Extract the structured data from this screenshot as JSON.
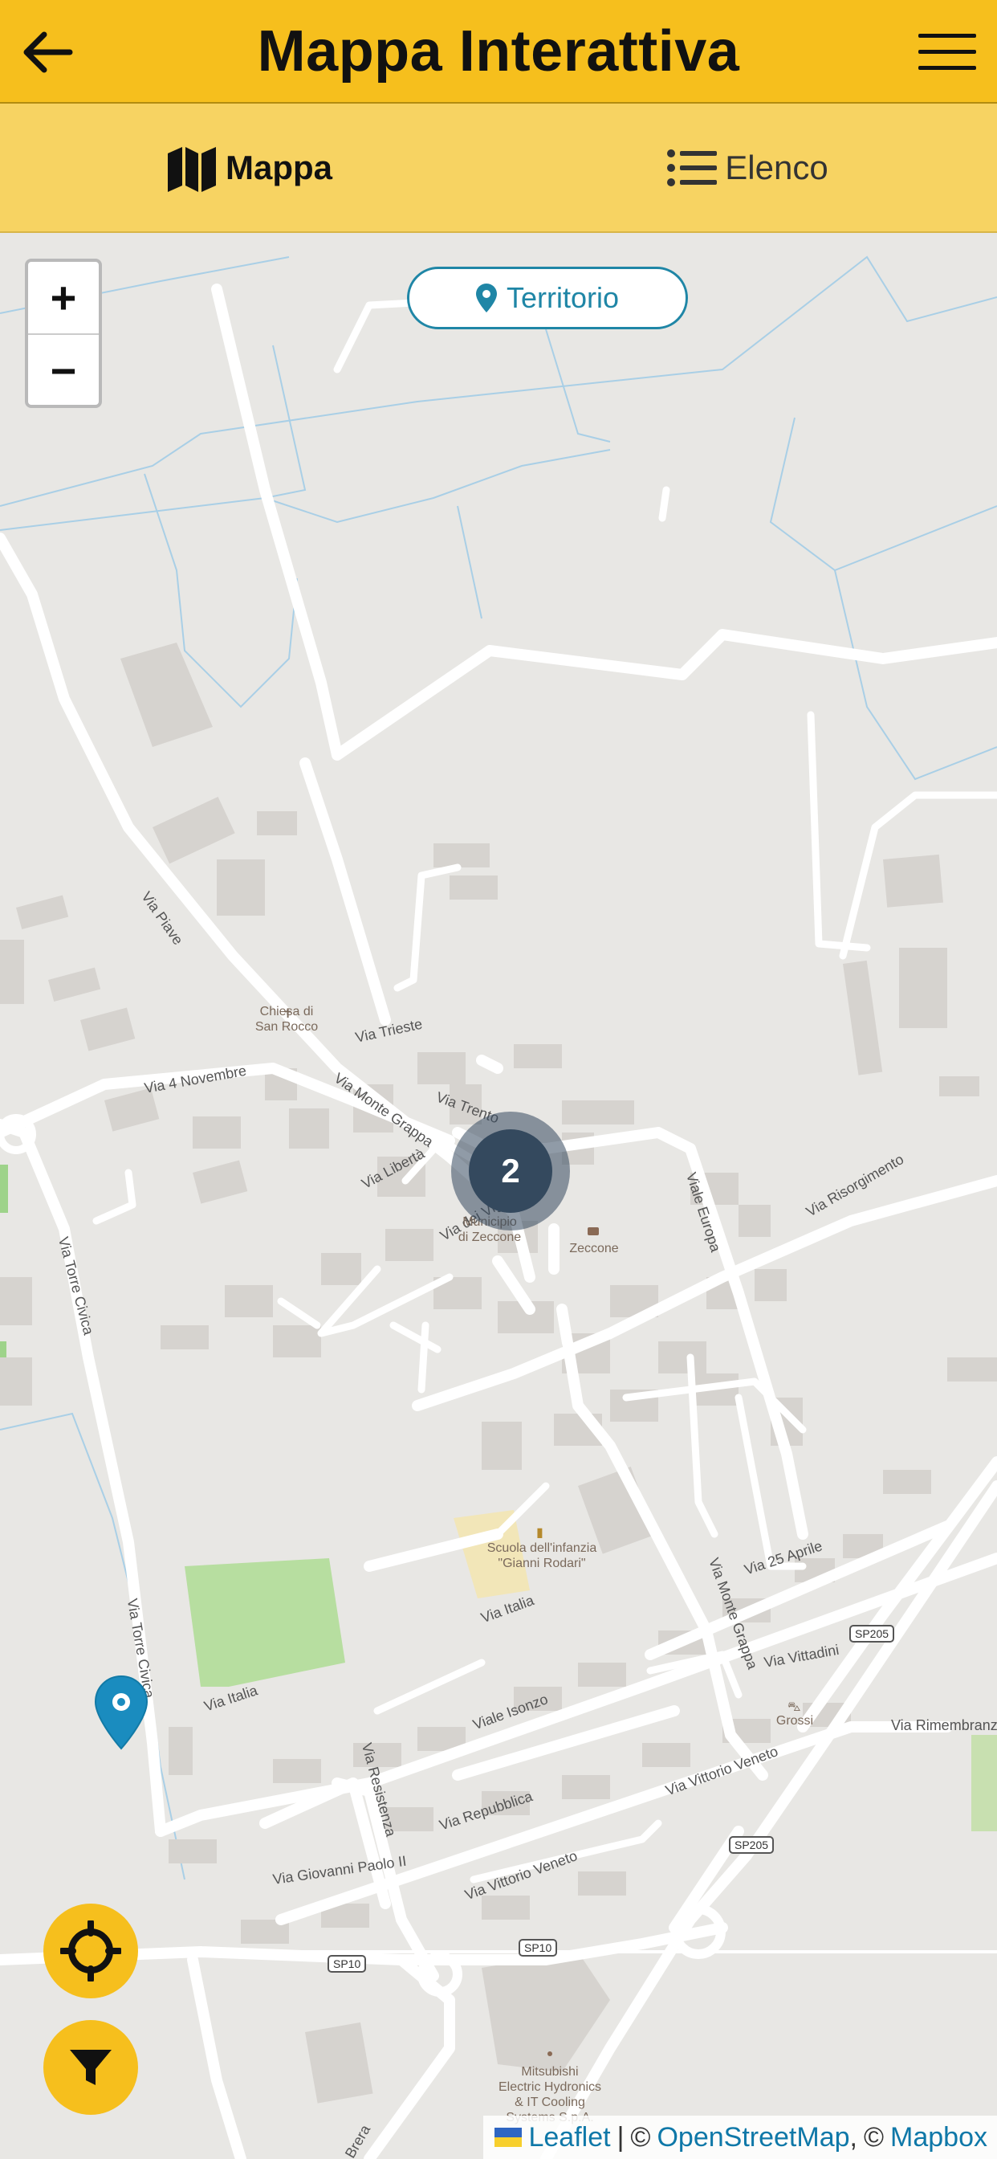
{
  "header": {
    "title": "Mappa Interattiva",
    "back_icon": "arrow-left-icon",
    "menu_icon": "hamburger-menu-icon"
  },
  "tabs": [
    {
      "label": "Mappa",
      "icon": "map-icon",
      "active": true
    },
    {
      "label": "Elenco",
      "icon": "list-icon",
      "active": false
    }
  ],
  "map": {
    "zoom_in_label": "+",
    "zoom_out_label": "−",
    "territorio_label": "Territorio",
    "cluster_count": "2",
    "streets": [
      "Via Piave",
      "Via Trieste",
      "Via 4 Novembre",
      "Via Monte Grappa",
      "Via Trento",
      "Via Libertà",
      "Via dei Vignoli",
      "Viale Europa",
      "Via Risorgimento",
      "Via Torre Civica",
      "Via Torre Civica",
      "Via 25 Aprile",
      "Via Italia",
      "Via Italia",
      "Via Monte Grappa",
      "Via Vittadini",
      "Viale Isonzo",
      "Via Resistenza",
      "Via Rimembranze",
      "Via Repubblica",
      "Via Vittorio Veneto",
      "Via Giovanni Paolo II",
      "Via Vittorio Veneto",
      "Brera"
    ],
    "pois": [
      "Chiesa di\nSan Rocco",
      "Municipio\ndi Zeccone",
      "Zeccone",
      "Scuola dell'infanzia\n\"Gianni Rodari\"",
      "Grossi",
      "Mitsubishi\nElectric Hydronics\n& IT Cooling\nSystems S.p.A."
    ],
    "road_shields": [
      "SP205",
      "SP205",
      "SP10",
      "SP10"
    ]
  },
  "fabs": {
    "locate_icon": "crosshair-locate-icon",
    "filter_icon": "filter-funnel-icon"
  },
  "attribution": {
    "leaflet": "Leaflet",
    "sep": "|",
    "copy1": "©",
    "osm": "OpenStreetMap",
    "comma": ",",
    "copy2": "©",
    "mapbox": "Mapbox"
  },
  "colors": {
    "brand_yellow": "#f6bf1d",
    "tabs_bg": "#f7d362",
    "accent_blue": "#1f86a6",
    "cluster": "#34495e",
    "map_bg": "#e8e7e4"
  }
}
